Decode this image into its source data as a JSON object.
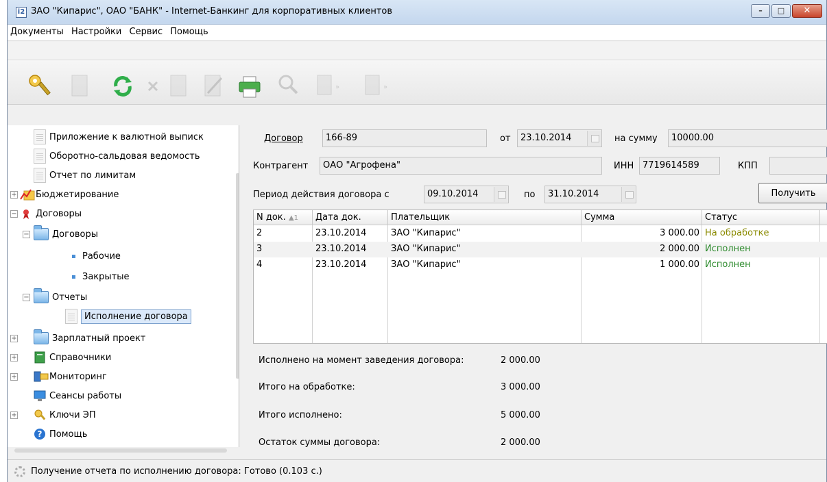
{
  "window": {
    "title": "ЗАО \"Кипарис\", ОАО \"БАНК\" - Internet-Банкинг для корпоративных клиентов"
  },
  "menu": [
    "Документы",
    "Настройки",
    "Сервис",
    "Помощь"
  ],
  "toolbar": {
    "icons": [
      "key-icon",
      "new-document-icon",
      "refresh-icon",
      "delete-icon",
      "save-icon",
      "edit-icon",
      "print-icon",
      "search-icon",
      "import-icon",
      "export-icon"
    ]
  },
  "tree": {
    "items": [
      {
        "label": "Приложение к валютной выписк",
        "icon": "document-icon"
      },
      {
        "label": "Оборотно-сальдовая ведомость",
        "icon": "document-icon"
      },
      {
        "label": "Отчет по лимитам",
        "icon": "document-icon"
      },
      {
        "label": "Бюджетирование",
        "icon": "chart-folder-icon"
      },
      {
        "label": "Договоры",
        "icon": "contract-icon"
      },
      {
        "label": "Договоры",
        "icon": "folder-icon"
      },
      {
        "label": "Рабочие",
        "icon": "bullet-icon"
      },
      {
        "label": "Закрытые",
        "icon": "bullet-icon"
      },
      {
        "label": "Отчеты",
        "icon": "folder-icon"
      },
      {
        "label": "Исполнение договора",
        "icon": "document-icon"
      },
      {
        "label": "Зарплатный проект",
        "icon": "folder-icon"
      },
      {
        "label": "Справочники",
        "icon": "book-icon"
      },
      {
        "label": "Мониторинг",
        "icon": "monitor-icon"
      },
      {
        "label": "Сеансы работы",
        "icon": "computer-icon"
      },
      {
        "label": "Ключи ЭП",
        "icon": "key-icon"
      },
      {
        "label": "Помощь",
        "icon": "help-icon"
      }
    ]
  },
  "form": {
    "contract_label": "Договор",
    "contract_value": "166-89",
    "from_label": "от",
    "from_date": "23.10.2014",
    "amount_label": "на сумму",
    "amount_value": "10000.00",
    "counterparty_label": "Контрагент",
    "counterparty_value": "ОАО \"Агрофена\"",
    "inn_label": "ИНН",
    "inn_value": "7719614589",
    "kpp_label": "КПП",
    "kpp_value": "",
    "period_label": "Период действия договора с",
    "period_from": "09.10.2014",
    "period_to_label": "по",
    "period_to": "31.10.2014",
    "get_button": "Получить"
  },
  "grid": {
    "headers": [
      "N док.",
      "Дата док.",
      "Плательщик",
      "Сумма",
      "Статус"
    ],
    "sort_indicator": "▲1",
    "rows": [
      {
        "num": "2",
        "date": "23.10.2014",
        "payer": "ЗАО \"Кипарис\"",
        "sum": "3 000.00",
        "status": "На обработке"
      },
      {
        "num": "3",
        "date": "23.10.2014",
        "payer": "ЗАО \"Кипарис\"",
        "sum": "2 000.00",
        "status": "Исполнен"
      },
      {
        "num": "4",
        "date": "23.10.2014",
        "payer": "ЗАО \"Кипарис\"",
        "sum": "1 000.00",
        "status": "Исполнен"
      }
    ],
    "status_colors": {
      "processing": "#8a8a00",
      "done": "#2e8b2e"
    }
  },
  "summary": {
    "executed_at_start_label": "Исполнено на момент заведения договора:",
    "executed_at_start_value": "2 000.00",
    "processing_total_label": "Итого на обработке:",
    "processing_total_value": "3 000.00",
    "executed_total_label": "Итого исполнено:",
    "executed_total_value": "5 000.00",
    "remaining_label": "Остаток суммы договора:",
    "remaining_value": "2 000.00"
  },
  "status_bar": {
    "text": "Получение отчета по исполнению договора: Готово (0.103 с.)"
  }
}
